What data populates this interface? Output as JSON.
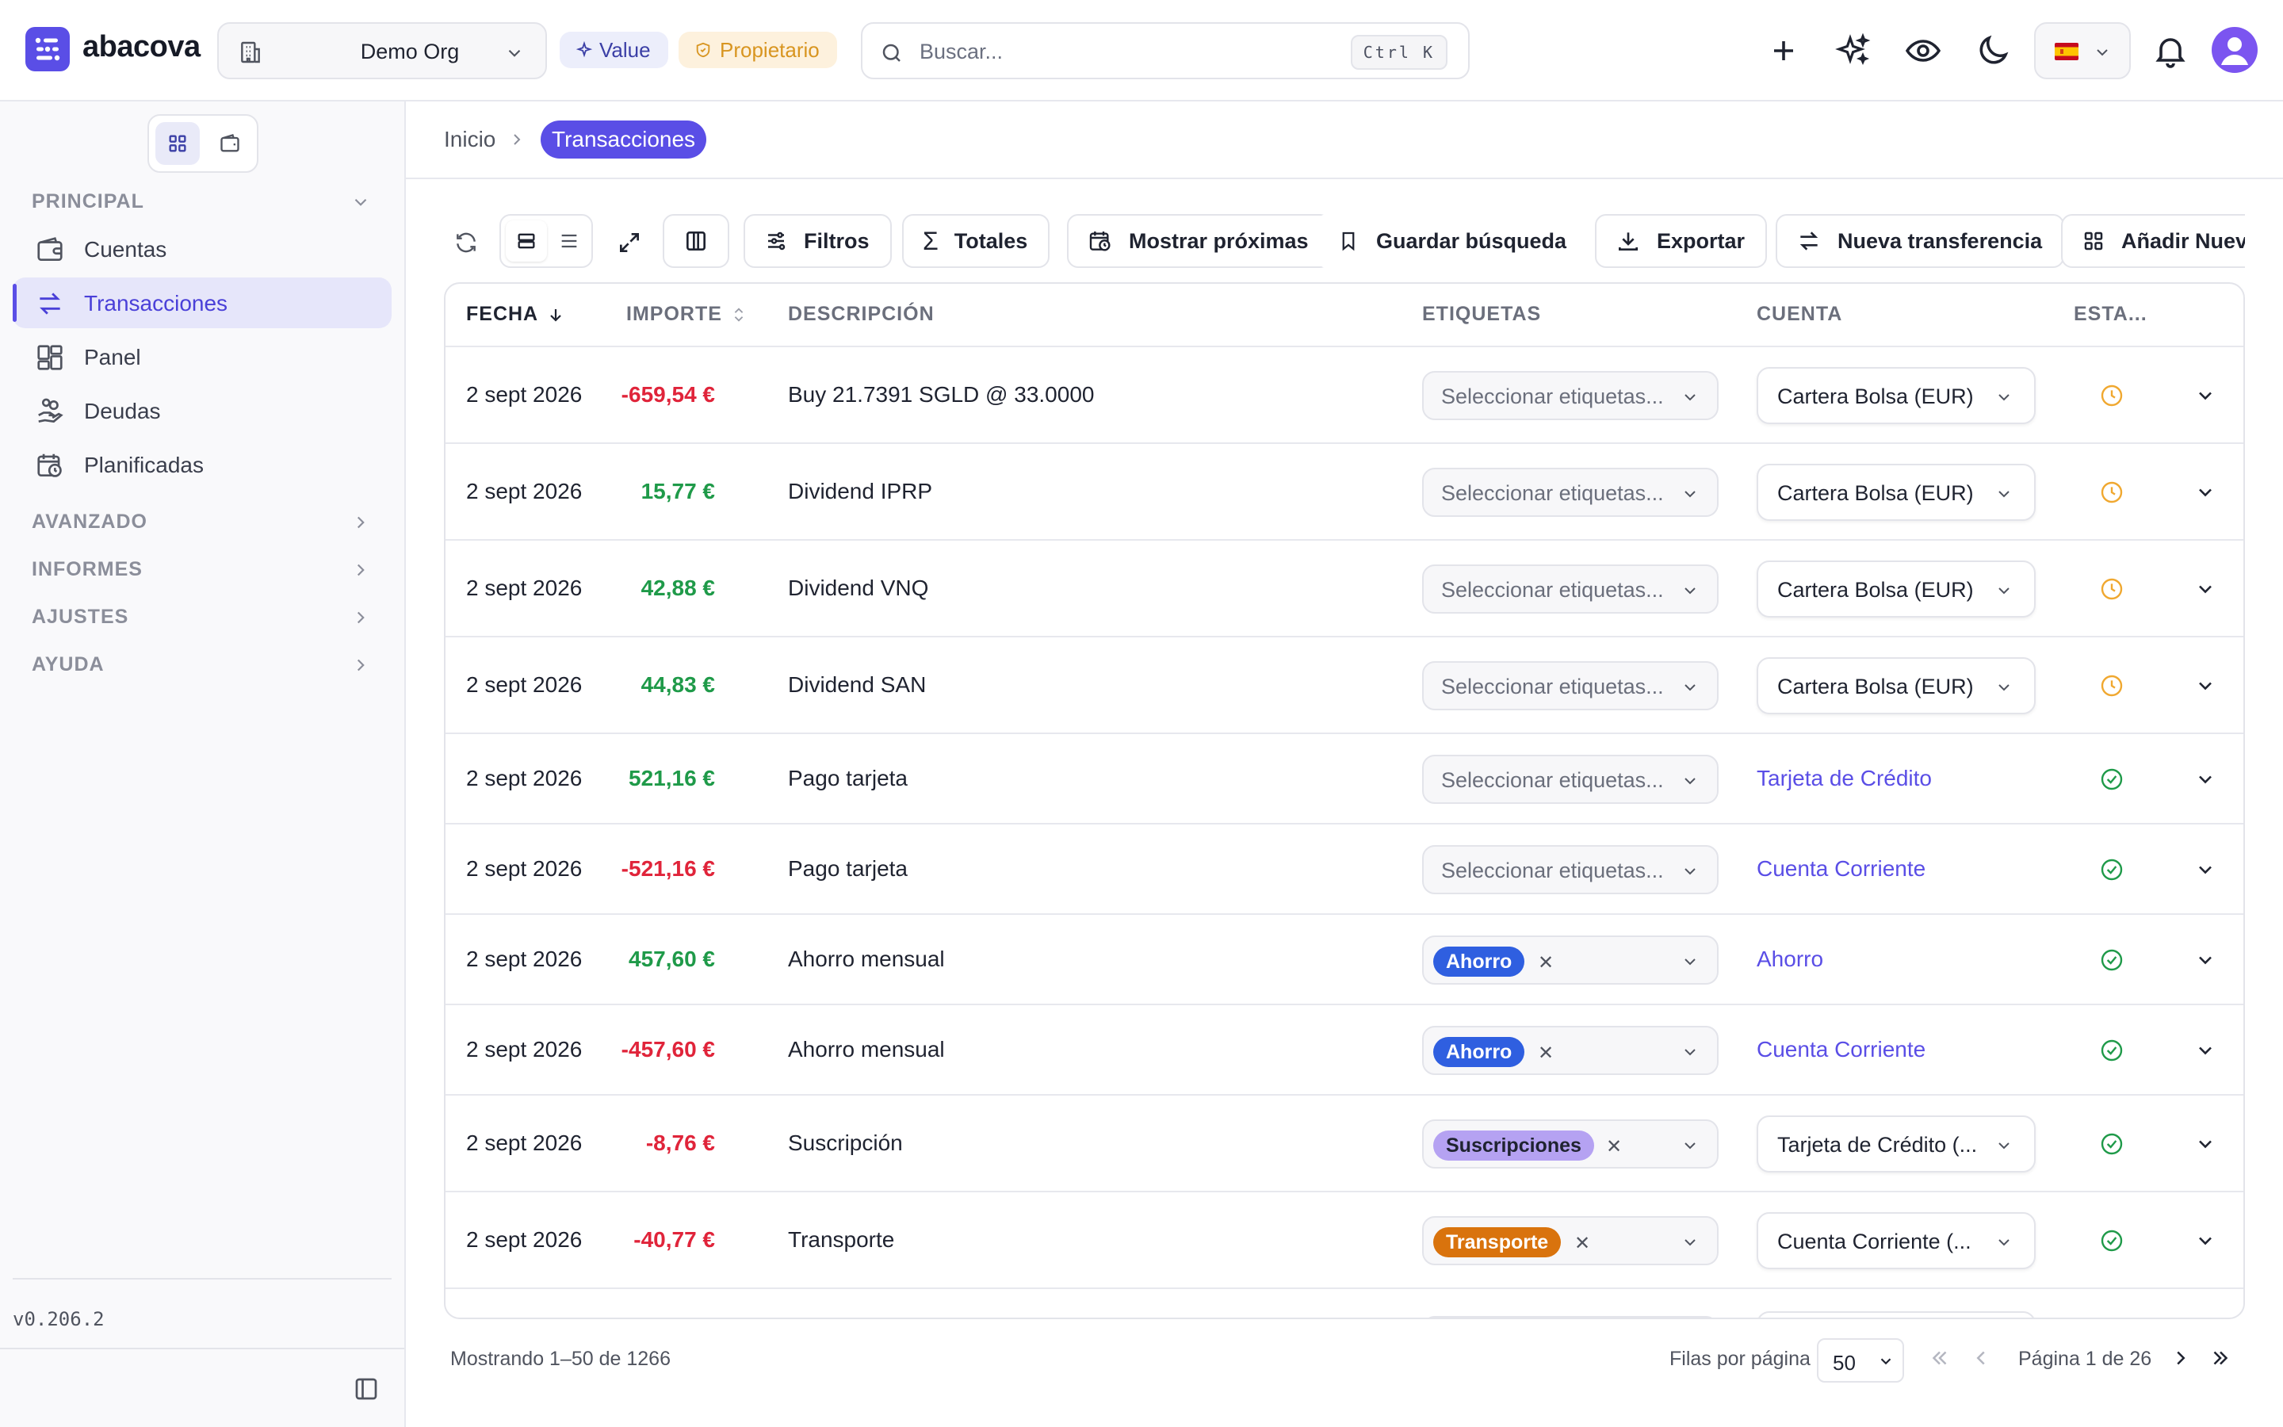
{
  "app": {
    "name": "abacova"
  },
  "header": {
    "org": "Demo Org",
    "plan_badge": "Value",
    "role_badge": "Propietario",
    "search_placeholder": "Buscar...",
    "search_shortcut": "Ctrl K",
    "icons": [
      "plus-icon",
      "sparkles-icon",
      "eye-icon",
      "moon-icon",
      "spain-flag-icon",
      "bell-icon",
      "user-avatar"
    ]
  },
  "sidebar": {
    "sections": {
      "principal": "PRINCIPAL",
      "avanzado": "AVANZADO",
      "informes": "INFORMES",
      "ajustes": "AJUSTES",
      "ayuda": "AYUDA"
    },
    "items": [
      {
        "label": "Cuentas",
        "icon": "wallet-icon"
      },
      {
        "label": "Transacciones",
        "icon": "arrows-exchange-icon",
        "active": true
      },
      {
        "label": "Panel",
        "icon": "dashboard-icon"
      },
      {
        "label": "Deudas",
        "icon": "hand-coins-icon"
      },
      {
        "label": "Planificadas",
        "icon": "calendar-clock-icon"
      }
    ],
    "version": "v0.206.2"
  },
  "breadcrumb": {
    "home": "Inicio",
    "current": "Transacciones"
  },
  "toolbar": {
    "filters": "Filtros",
    "totals": "Totales",
    "show_upcoming": "Mostrar próximas",
    "save_search": "Guardar búsqueda",
    "export": "Exportar",
    "new_transfer": "Nueva transferencia",
    "add_new": "Añadir Nueva"
  },
  "table": {
    "headers": {
      "date": "FECHA",
      "amount": "IMPORTE",
      "description": "DESCRIPCIÓN",
      "tags": "ETIQUETAS",
      "account": "CUENTA",
      "status": "ESTA..."
    },
    "tag_placeholder": "Seleccionar etiquetas...",
    "rows": [
      {
        "date": "2 sept 2026",
        "amount": "-659,54 €",
        "sign": "neg",
        "description": "Buy 21.7391 SGLD @ 33.0000",
        "tag": "",
        "account": "Cartera Bolsa (EUR)",
        "account_style": "select",
        "status": "pending"
      },
      {
        "date": "2 sept 2026",
        "amount": "15,77 €",
        "sign": "pos",
        "description": "Dividend IPRP",
        "tag": "",
        "account": "Cartera Bolsa (EUR)",
        "account_style": "select",
        "status": "pending"
      },
      {
        "date": "2 sept 2026",
        "amount": "42,88 €",
        "sign": "pos",
        "description": "Dividend VNQ",
        "tag": "",
        "account": "Cartera Bolsa (EUR)",
        "account_style": "select",
        "status": "pending"
      },
      {
        "date": "2 sept 2026",
        "amount": "44,83 €",
        "sign": "pos",
        "description": "Dividend SAN",
        "tag": "",
        "account": "Cartera Bolsa (EUR)",
        "account_style": "select",
        "status": "pending"
      },
      {
        "date": "2 sept 2026",
        "amount": "521,16 €",
        "sign": "pos",
        "description": "Pago tarjeta",
        "tag": "",
        "account": "Tarjeta de Crédito",
        "account_style": "link",
        "status": "cleared"
      },
      {
        "date": "2 sept 2026",
        "amount": "-521,16 €",
        "sign": "neg",
        "description": "Pago tarjeta",
        "tag": "",
        "account": "Cuenta Corriente",
        "account_style": "link",
        "status": "cleared"
      },
      {
        "date": "2 sept 2026",
        "amount": "457,60 €",
        "sign": "pos",
        "description": "Ahorro mensual",
        "tag": "Ahorro",
        "tag_bg": "#2f5fe0",
        "tag_fg": "#ffffff",
        "account": "Ahorro",
        "account_style": "link",
        "status": "cleared"
      },
      {
        "date": "2 sept 2026",
        "amount": "-457,60 €",
        "sign": "neg",
        "description": "Ahorro mensual",
        "tag": "Ahorro",
        "tag_bg": "#2f5fe0",
        "tag_fg": "#ffffff",
        "account": "Cuenta Corriente",
        "account_style": "link",
        "status": "cleared"
      },
      {
        "date": "2 sept 2026",
        "amount": "-8,76 €",
        "sign": "neg",
        "description": "Suscripción",
        "tag": "Suscripciones",
        "tag_bg": "#b5a2f2",
        "tag_fg": "#1f2330",
        "account": "Tarjeta de Crédito (...",
        "account_style": "select",
        "status": "cleared"
      },
      {
        "date": "2 sept 2026",
        "amount": "-40,77 €",
        "sign": "neg",
        "description": "Transporte",
        "tag": "Transporte",
        "tag_bg": "#d9730d",
        "tag_fg": "#ffffff",
        "account": "Cuenta Corriente (...",
        "account_style": "select",
        "status": "cleared"
      }
    ]
  },
  "footer": {
    "showing": "Mostrando 1–50 de 1266",
    "rows_per_page_label": "Filas por página",
    "rows_per_page": "50",
    "page": "Página 1 de 26"
  },
  "colors": {
    "accent": "#5a4ee6",
    "negative": "#e0243a",
    "positive": "#1f9a49",
    "pending": "#f0a830",
    "cleared": "#1f9a49"
  }
}
